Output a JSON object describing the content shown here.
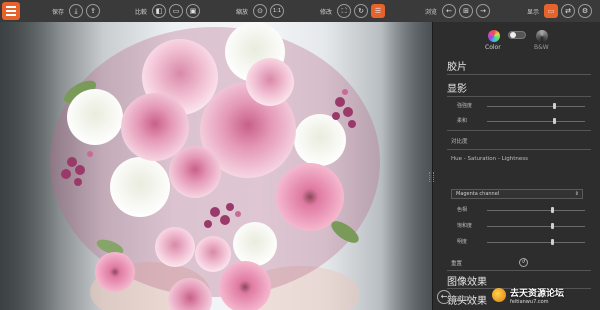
{
  "toolbar": {
    "save_label": "保存",
    "compare_label": "比較",
    "zoom_label": "縮放",
    "zoom_ratio": "1:1",
    "edit_label": "修改",
    "browse_label": "浏览",
    "display_label": "显示"
  },
  "panel": {
    "color_mode": {
      "color_label": "Color",
      "bw_label": "B&W",
      "selected": "Color"
    },
    "film_title": "胶片",
    "develop_title": "显影",
    "develop_rows": [
      {
        "label": "強強度",
        "value": 0.68
      },
      {
        "label": "柔和",
        "value": 0.68
      }
    ],
    "contrast_label": "对比度",
    "hsl_label": "Hue - Saturation - Lightness",
    "channel_select": "Magenta channel",
    "hsl_rows": [
      {
        "label": "色相",
        "value": 0.66
      },
      {
        "label": "饱和度",
        "value": 0.66
      },
      {
        "label": "明度",
        "value": 0.66
      }
    ],
    "reset_label": "重置",
    "image_effects_title": "图像效果",
    "lens_effects_title": "镜头效果",
    "back_label": "返回"
  },
  "watermark": {
    "text": "去天资源论坛",
    "url": "feitianwu7.com"
  },
  "colors": {
    "accent": "#e8632b",
    "panel_bg": "#2d2d2d",
    "toolbar_bg": "#3a3a3a"
  }
}
